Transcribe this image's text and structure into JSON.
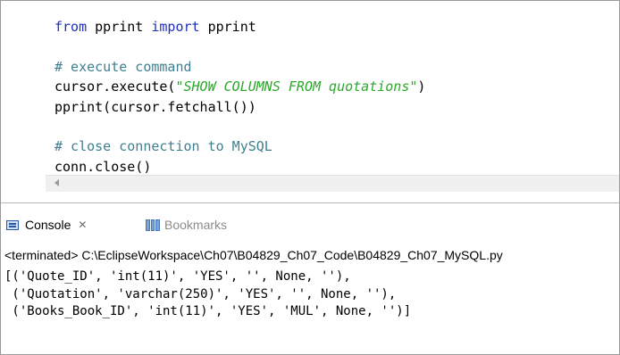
{
  "editor": {
    "lines": [
      {
        "kw1": "from",
        "t1": " pprint ",
        "kw2": "import",
        "t2": " pprint"
      },
      {
        "text": ""
      },
      {
        "comment": "# execute command"
      },
      {
        "pre": "cursor.execute(",
        "str": "\"SHOW COLUMNS FROM quotations\"",
        "post": ")"
      },
      {
        "text": "pprint(cursor.fetchall())"
      },
      {
        "text": ""
      },
      {
        "comment": "# close connection to MySQL"
      },
      {
        "text": "conn.close()"
      }
    ]
  },
  "tabs": {
    "console": "Console",
    "console_close": "✕",
    "bookmarks": "Bookmarks"
  },
  "console": {
    "terminated": "<terminated> C:\\EclipseWorkspace\\Ch07\\B04829_Ch07_Code\\B04829_Ch07_MySQL.py",
    "output": [
      "[('Quote_ID', 'int(11)', 'YES', '', None, ''),",
      " ('Quotation', 'varchar(250)', 'YES', '', None, ''),",
      " ('Books_Book_ID', 'int(11)', 'YES', 'MUL', None, '')]"
    ]
  },
  "icons": {
    "console": "console-icon",
    "bookmarks": "bookmarks-icon",
    "scroll_left": "chevron-left-icon"
  }
}
